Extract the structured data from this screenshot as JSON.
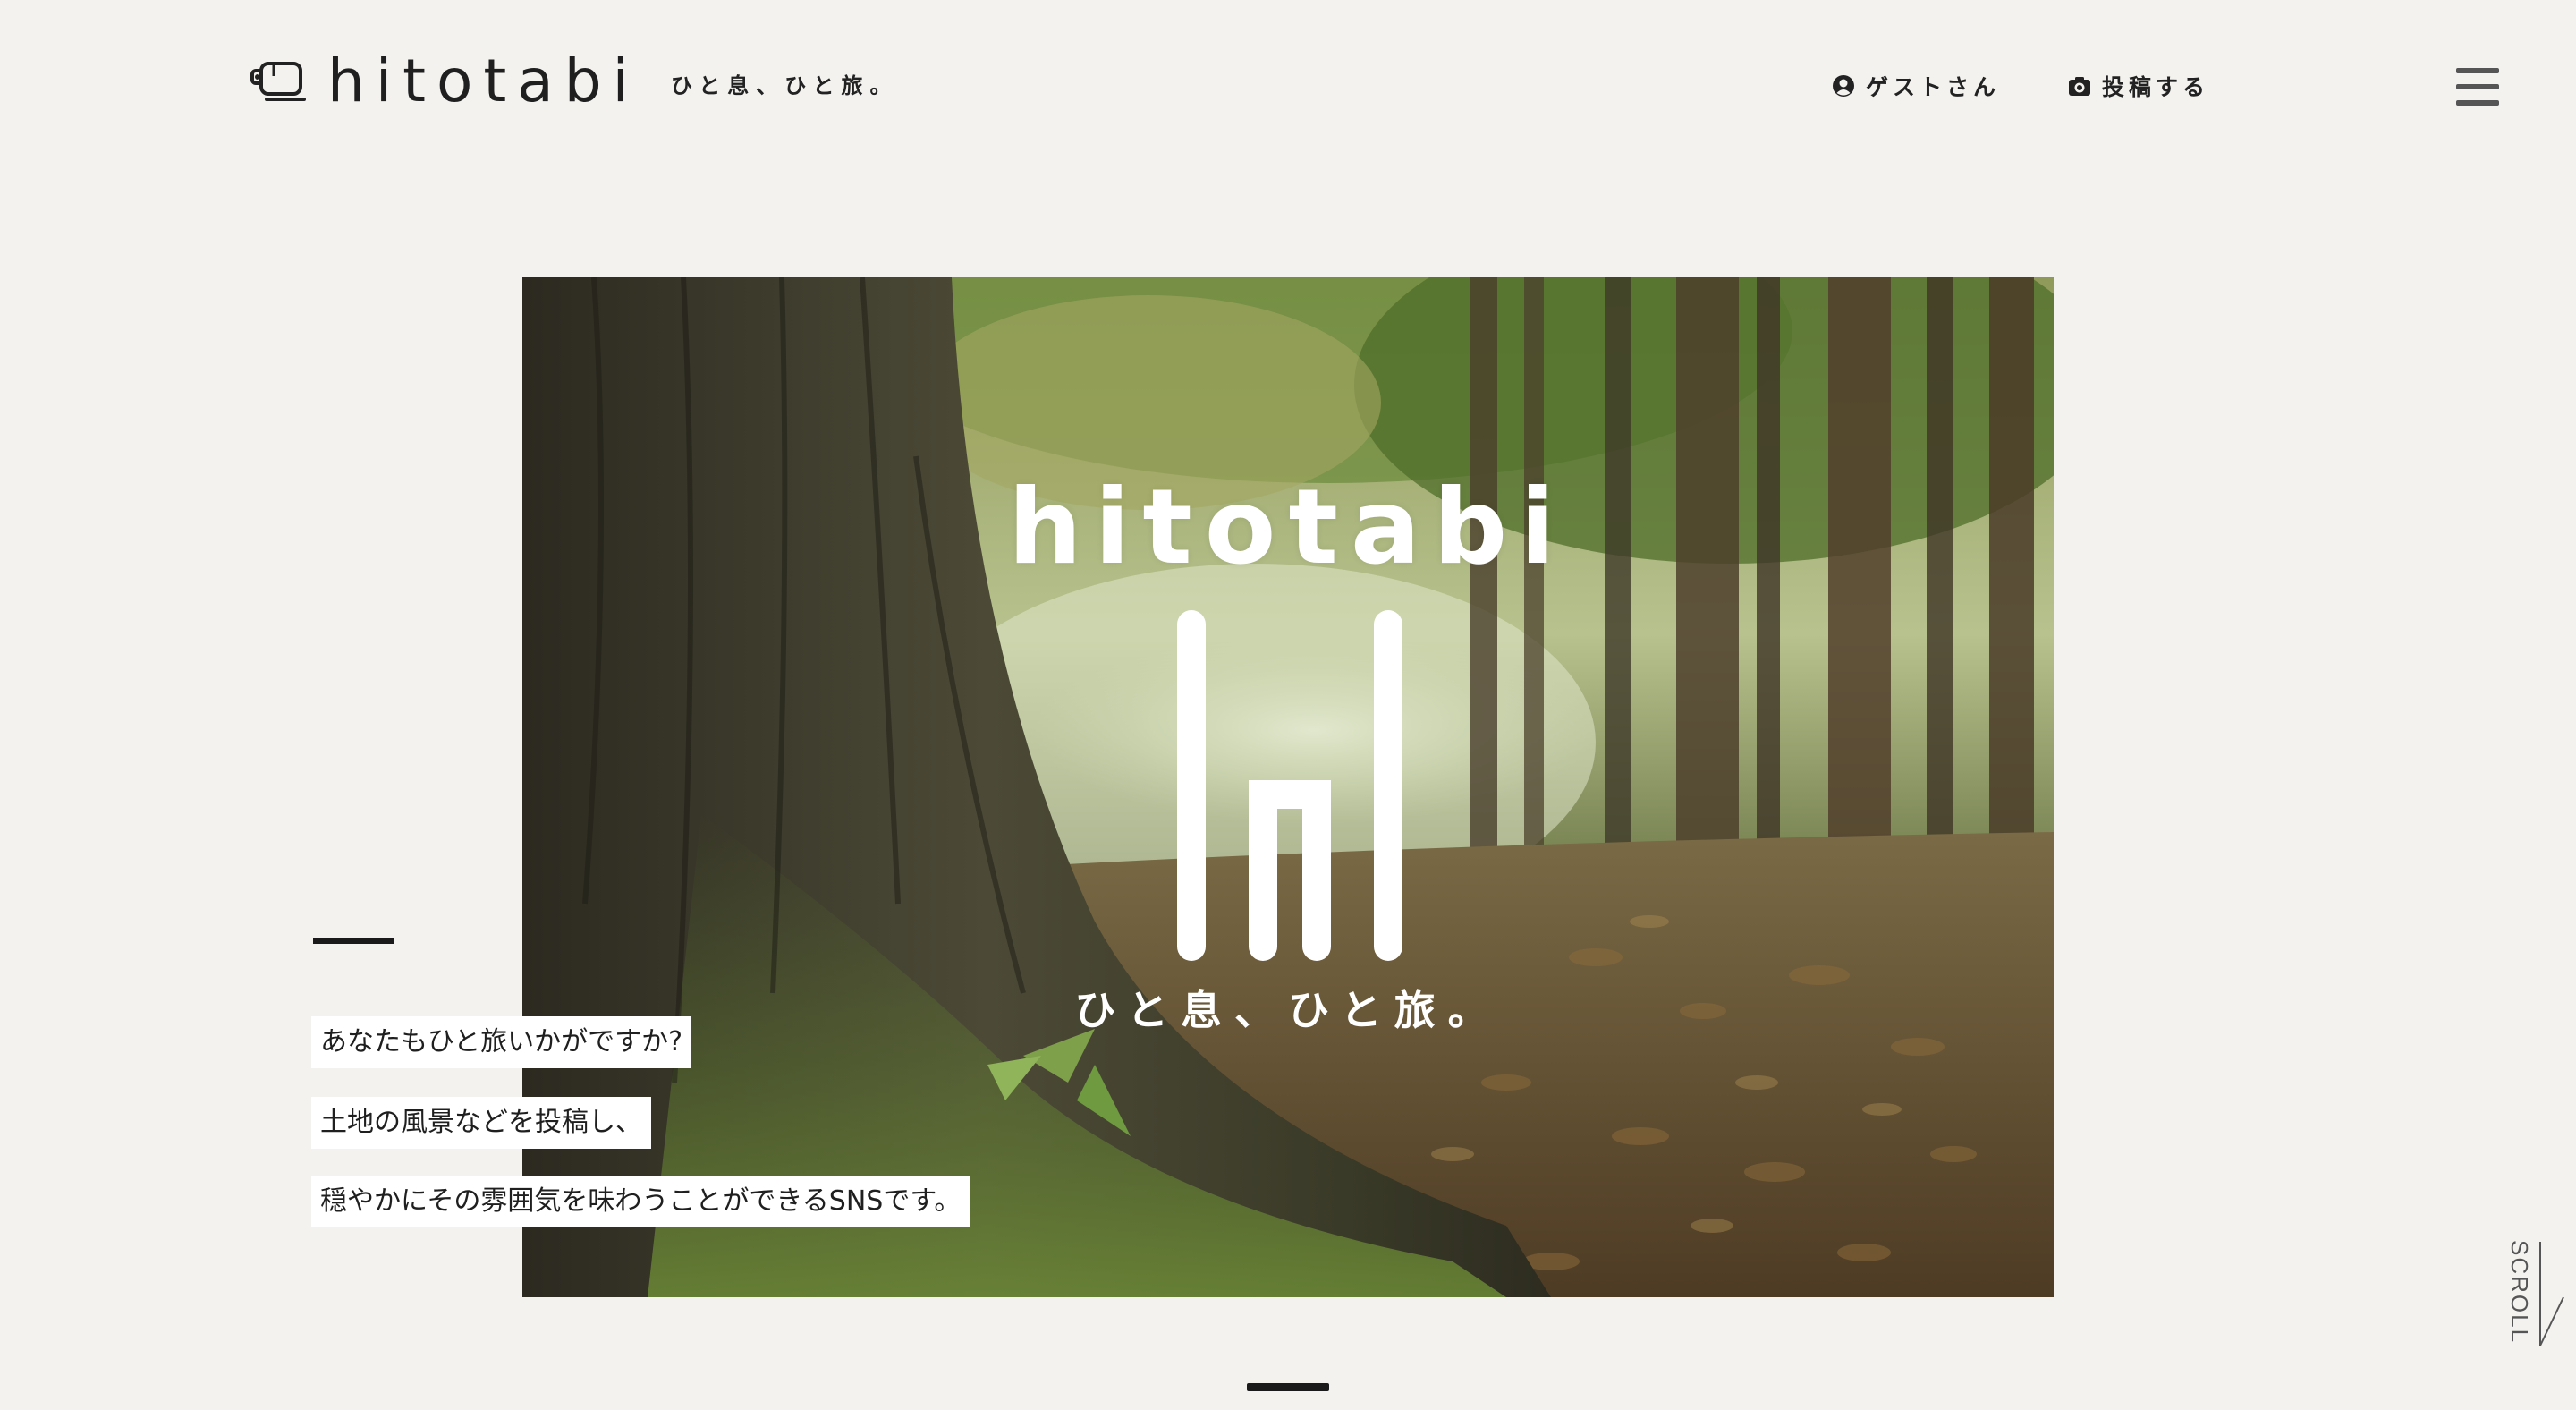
{
  "header": {
    "logo_text": "hitotabi",
    "tagline": "ひと息、ひと旅。",
    "nav": {
      "guest_label": "ゲストさん",
      "guest_icon": "user-circle-icon",
      "post_label": "投稿する",
      "post_icon": "camera-icon"
    },
    "menu_icon": "hamburger-menu-icon"
  },
  "hero": {
    "brand": "hitotabi",
    "tagline": "ひと息、ひと旅。",
    "image_subject": "forest-tree-trunk"
  },
  "intro": {
    "lines": [
      "あなたもひと旅いかがですか?",
      "土地の風景などを投稿し、",
      "穏やかにその雰囲気を味わうことができるSNSです。"
    ]
  },
  "scroll": {
    "label": "SCROLL"
  },
  "colors": {
    "background": "#f3f2ef",
    "text": "#222222",
    "accent": "#1a1a1a",
    "hero_text": "#ffffff"
  }
}
